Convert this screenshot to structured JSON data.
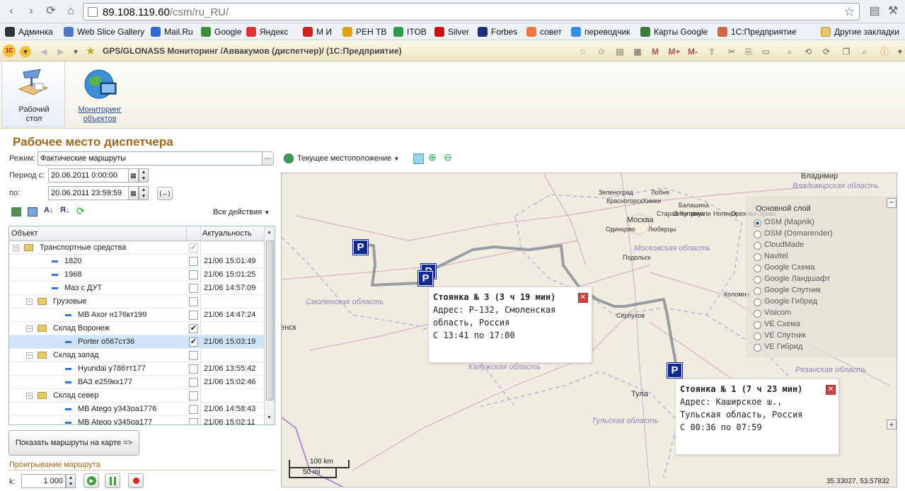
{
  "browser": {
    "url_host": "89.108.119.60",
    "url_path": "/csm/ru_RU/",
    "bookmarks": [
      "Админка",
      "Web Slice Gallery",
      "Mail.Ru",
      "Google",
      "Яндекс",
      "М И",
      "РЕН ТВ",
      "ITOB",
      "Silver",
      "Forbes",
      "совет",
      "переводчик",
      "Карты Google",
      "1С:Предприятие"
    ],
    "other_bookmarks": "Другие закладки",
    "bookmark_colors": [
      "#333",
      "#4a79c8",
      "#2d6ad6",
      "#3b8e3b",
      "#d33",
      "#c22",
      "#e0a21a",
      "#2e9a4a",
      "#c11",
      "#1a2f7a",
      "#e74",
      "#3a8ee0",
      "#3b7a3b",
      "#c64"
    ]
  },
  "app": {
    "window_title": "GPS/GLONASS Мониторинг /Аввакумов (диспетчер)/ (1С:Предприятие)",
    "toolbar_m": "M",
    "toolbar_mplus": "M+",
    "toolbar_mminus": "M-",
    "sections": [
      {
        "label": "Рабочий стол",
        "line1": "Рабочий",
        "line2": "стол"
      },
      {
        "label": "Мониторинг объектов",
        "line1": "Мониторинг",
        "line2": "объектов"
      }
    ]
  },
  "panel": {
    "title": "Рабочее место диспетчера",
    "mode_label": "Режим:",
    "mode_value": "Фактические маршруты",
    "period_from_label": "Период с:",
    "period_from": "20.06.2011  0:00:00",
    "period_to_label": "по:",
    "period_to": "20.06.2011 23:59:59",
    "all_actions": "Все действия",
    "col_object": "Объект",
    "col_actual": "Актуальность",
    "rows": [
      {
        "level": 0,
        "type": "folder",
        "name": "Транспортные средства",
        "checked": true,
        "disabled": true,
        "date": ""
      },
      {
        "level": 1,
        "type": "vehicle",
        "name": "1820",
        "checked": false,
        "date": "21/06 15:01:49"
      },
      {
        "level": 1,
        "type": "vehicle",
        "name": "1968",
        "checked": false,
        "date": "21/06 15:01:25"
      },
      {
        "level": 1,
        "type": "vehicle",
        "name": "Маз с ДУТ",
        "checked": false,
        "date": "21/06 14:57:09"
      },
      {
        "level": 1,
        "type": "folder",
        "name": "Грузовые",
        "checked": false,
        "date": ""
      },
      {
        "level": 2,
        "type": "vehicle",
        "name": "MB Axor н176кт199",
        "checked": false,
        "date": "21/06 14:47:24"
      },
      {
        "level": 1,
        "type": "folder",
        "name": "Склад Воронеж",
        "checked": true,
        "date": ""
      },
      {
        "level": 2,
        "type": "vehicle",
        "name": "Porter о567ст36",
        "checked": true,
        "date": "21/06 15:03:19",
        "selected": true
      },
      {
        "level": 1,
        "type": "folder",
        "name": "Склад запад",
        "checked": false,
        "date": ""
      },
      {
        "level": 2,
        "type": "vehicle",
        "name": "Hyundai у786тт177",
        "checked": false,
        "date": "21/06 13:55:42"
      },
      {
        "level": 2,
        "type": "vehicle",
        "name": "ВАЗ е259кх177",
        "checked": false,
        "date": "21/06 15:02:46"
      },
      {
        "level": 1,
        "type": "folder",
        "name": "Склад север",
        "checked": false,
        "date": ""
      },
      {
        "level": 2,
        "type": "vehicle",
        "name": "MB Atego у343оа1776",
        "checked": false,
        "date": "21/06 14:58:43"
      },
      {
        "level": 2,
        "type": "vehicle",
        "name": "MB Atego у345оа177",
        "checked": false,
        "date": "21/06 15:02:11"
      }
    ],
    "show_routes_button": "Показать маршруты на карте =>",
    "playback_label": "Проигрывание маршрута",
    "k_label": "k:",
    "k_value": "1 000"
  },
  "map_toolbar": {
    "location_label": "Текущее местоположение"
  },
  "map": {
    "towns": [
      "Владимир",
      "Зеленоград",
      "Лобня",
      "Красногорск",
      "Химки",
      "Балашиха",
      "Старая Купавна",
      "Электроугли",
      "Ногинск",
      "Орехово-Зуево",
      "Москва",
      "Одинцово",
      "Люберцы",
      "Подольск",
      "Серпухов",
      "Коломна",
      "Тула",
      "енск"
    ],
    "regions": [
      "Владимирская область",
      "Московская область",
      "Смоленская область",
      "Калужская область",
      "Рязанская область",
      "Тульская область"
    ],
    "layers_title": "Основной слой",
    "layers": [
      {
        "name": "OSM (Mapnik)",
        "selected": true
      },
      {
        "name": "OSM (Osmarender)",
        "selected": false
      },
      {
        "name": "CloudMade",
        "selected": false
      },
      {
        "name": "Navitel",
        "selected": false
      },
      {
        "name": "Google Схема",
        "selected": false
      },
      {
        "name": "Google Ландшафт",
        "selected": false
      },
      {
        "name": "Google Спутник",
        "selected": false
      },
      {
        "name": "Google Гибрид",
        "selected": false
      },
      {
        "name": "Visicom",
        "selected": false
      },
      {
        "name": "VE Схема",
        "selected": false
      },
      {
        "name": "VE Спутник",
        "selected": false
      },
      {
        "name": "VE Гибрид",
        "selected": false
      }
    ],
    "popups": [
      {
        "title": "Стоянка № 3 (3 ч 19 мин)",
        "line1": "Адрес: Р-132, Смоленская",
        "line2": "область, Россия",
        "line3": "С 13:41 по 17:00"
      },
      {
        "title": "Стоянка № 1 (7 ч 23 мин)",
        "line1": "Адрес: Каширское ш.,",
        "line2": "Тульская область, Россия",
        "line3": "С 00:36 по 07:59"
      }
    ],
    "parking_letter": "P",
    "scale_km": "100 km",
    "scale_mi": "50 mi",
    "coords": "35.33027, 53.57832",
    "zoom_minus": "−",
    "zoom_plus": "+"
  }
}
